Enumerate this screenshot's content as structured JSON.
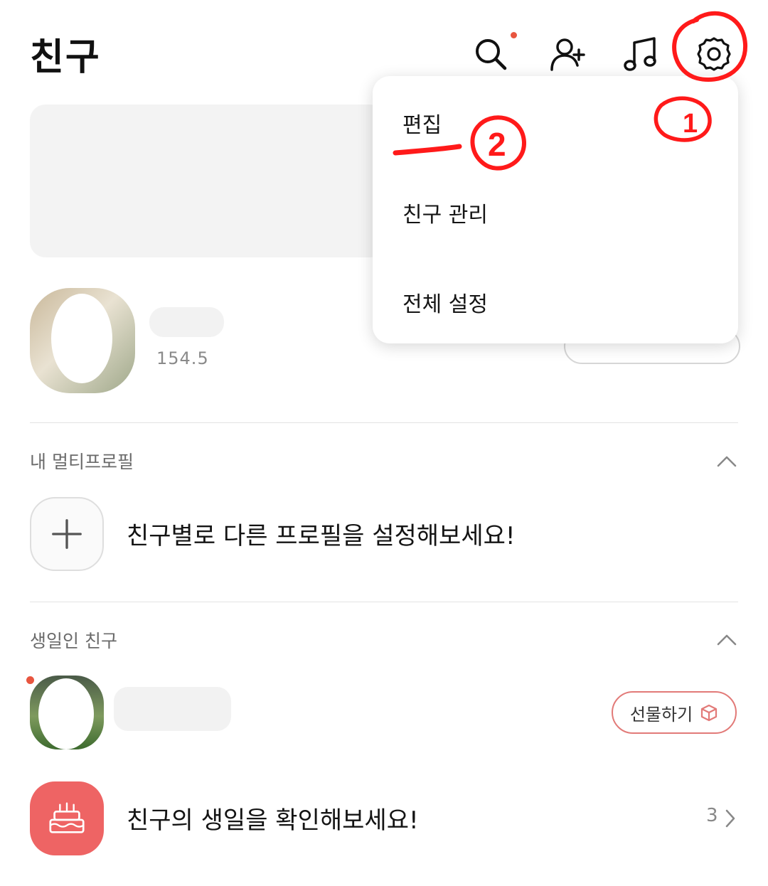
{
  "header": {
    "title": "친구",
    "icons": [
      "search-icon",
      "add-friend-icon",
      "music-icon",
      "gear-icon"
    ]
  },
  "profile": {
    "status": "154.5"
  },
  "sections": {
    "multi_profile": {
      "label": "내 멀티프로필",
      "prompt": "친구별로 다른 프로필을 설정해보세요!"
    },
    "birthday": {
      "label": "생일인 친구",
      "gift_label": "선물하기",
      "prompt": "친구의 생일을 확인해보세요!",
      "count": "3"
    }
  },
  "menu": {
    "items": [
      "편집",
      "친구 관리",
      "전체 설정"
    ]
  },
  "annotations": {
    "step1": "1",
    "step2": "2"
  },
  "colors": {
    "accent_red": "#e8553f",
    "annotation_red": "#ff1a1a",
    "birthday_tile": "#ee6464",
    "gift_border": "#e27a78"
  }
}
